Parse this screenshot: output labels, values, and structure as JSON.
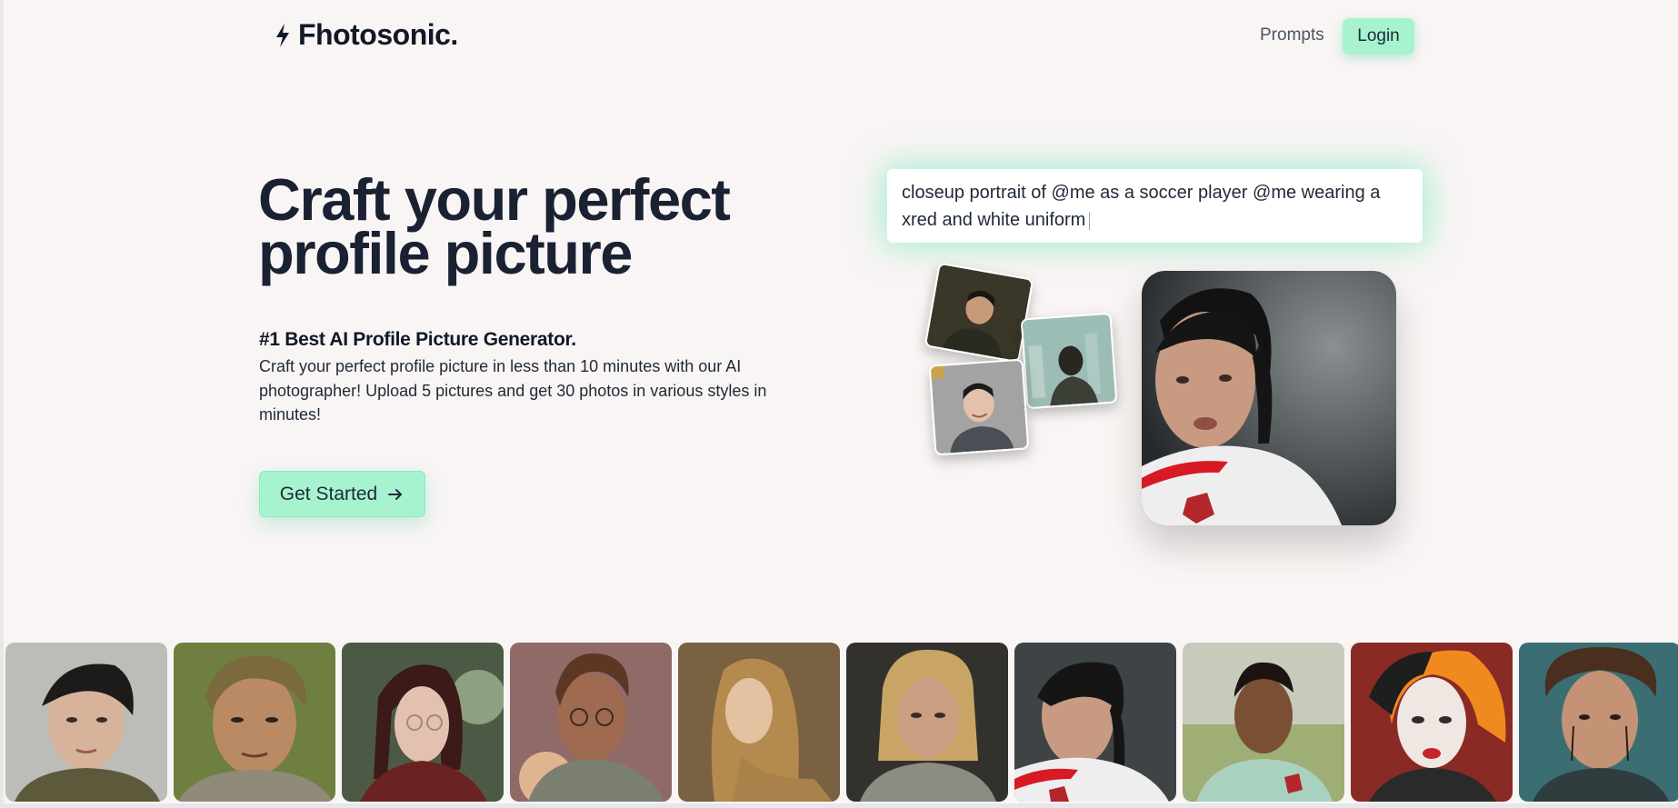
{
  "nav": {
    "brand": "Fhotosonic.",
    "brand_icon": "bolt-icon",
    "links": [
      {
        "label": "Prompts"
      }
    ],
    "login_label": "Login"
  },
  "hero": {
    "title": "Craft your perfect profile picture",
    "subtitle": "#1 Best AI Profile Picture Generator.",
    "description": "Craft your perfect profile picture in less than 10 minutes with our AI photographer! Upload 5 pictures and get 30 photos in various styles in minutes!",
    "cta_label": "Get Started",
    "cta_icon": "arrow-right-icon"
  },
  "demo": {
    "prompt_text": "closeup portrait of @me as a soccer player @me wearing a xred and white uniform"
  },
  "gallery": {
    "count": 10
  },
  "colors": {
    "accent": "#a7f3d0",
    "background": "#f9f5f4",
    "text": "#111827"
  }
}
